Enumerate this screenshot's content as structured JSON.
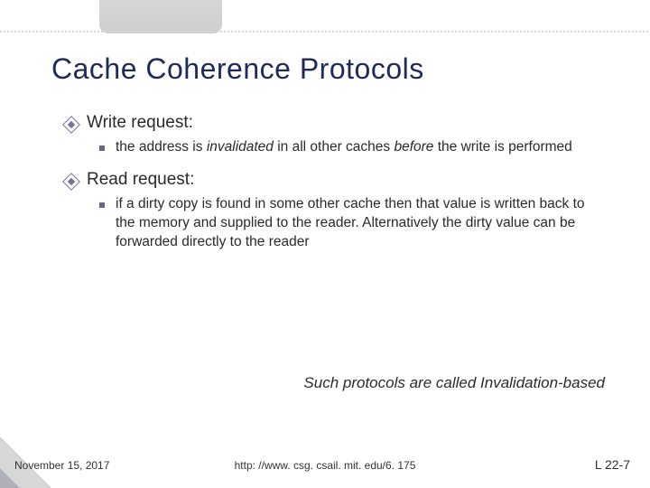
{
  "title": "Cache Coherence Protocols",
  "items": [
    {
      "heading": "Write request:",
      "sub_pre": "the address is ",
      "sub_em1": "invalidated",
      "sub_mid": " in all other caches ",
      "sub_em2": "before",
      "sub_post": " the write is performed"
    },
    {
      "heading": "Read request:",
      "sub_pre": "if a dirty copy is found in some other cache then that value is written back to the memory and supplied to the reader. Alternatively the dirty value can be forwarded directly to the reader",
      "sub_em1": "",
      "sub_mid": "",
      "sub_em2": "",
      "sub_post": ""
    }
  ],
  "tagline": "Such protocols are called Invalidation-based",
  "footer": {
    "date": "November 15, 2017",
    "url": "http: //www. csg. csail. mit. edu/6. 175",
    "page": "L 22-7"
  }
}
